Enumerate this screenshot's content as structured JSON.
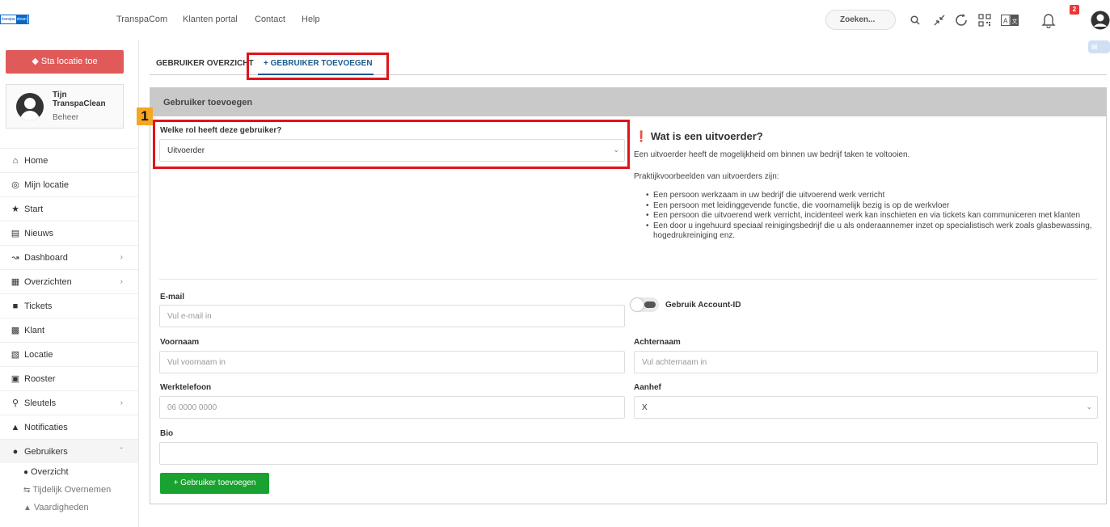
{
  "topbar": {
    "logo_text_1": "transpa",
    "logo_text_2": "clean",
    "nav": [
      "TranspaCom",
      "Klanten portal",
      "Contact",
      "Help"
    ],
    "search_placeholder": "Zoeken...",
    "notification_count": "2",
    "icons": [
      "search-icon",
      "collapse-icon",
      "refresh-icon",
      "qr-code-icon",
      "translate-icon",
      "bell-icon",
      "user-avatar-icon"
    ]
  },
  "sidebar": {
    "location_button": "Sta locatie toe",
    "profile": {
      "name": "Tijn",
      "company": "TranspaClean",
      "role": "Beheer"
    },
    "items": [
      {
        "label": "Home",
        "icon": "home-icon",
        "has_children": false
      },
      {
        "label": "Mijn locatie",
        "icon": "globe-icon",
        "has_children": false
      },
      {
        "label": "Start",
        "icon": "star-icon",
        "has_children": false
      },
      {
        "label": "Nieuws",
        "icon": "newspaper-icon",
        "has_children": false
      },
      {
        "label": "Dashboard",
        "icon": "chart-icon",
        "has_children": true
      },
      {
        "label": "Overzichten",
        "icon": "file-icon",
        "has_children": true
      },
      {
        "label": "Tickets",
        "icon": "comment-icon",
        "has_children": false
      },
      {
        "label": "Klant",
        "icon": "building-icon",
        "has_children": false
      },
      {
        "label": "Locatie",
        "icon": "location-building-icon",
        "has_children": false
      },
      {
        "label": "Rooster",
        "icon": "calendar-icon",
        "has_children": false
      },
      {
        "label": "Sleutels",
        "icon": "key-icon",
        "has_children": true
      },
      {
        "label": "Notificaties",
        "icon": "bell-icon",
        "has_children": false
      },
      {
        "label": "Gebruikers",
        "icon": "users-icon",
        "has_children": true
      }
    ],
    "subitems": [
      {
        "label": "Overzicht",
        "icon": "users-cog-icon"
      },
      {
        "label": "Tijdelijk Overnemen",
        "icon": "exchange-icon"
      },
      {
        "label": "Vaardigheden",
        "icon": "graduation-icon"
      }
    ]
  },
  "tabs": {
    "overview": "GEBRUIKER OVERZICHT",
    "add": "+ GEBRUIKER TOEVOEGEN"
  },
  "annotation": {
    "step_number": "1"
  },
  "form": {
    "card_title": "Gebruiker toevoegen",
    "role_label": "Welke rol heeft deze gebruiker?",
    "role_value": "Uitvoerder",
    "email_label": "E-mail",
    "email_placeholder": "Vul e-mail in",
    "account_id_label": "Gebruik Account-ID",
    "firstname_label": "Voornaam",
    "firstname_placeholder": "Vul voornaam in",
    "lastname_label": "Achternaam",
    "lastname_placeholder": "Vul achternaam in",
    "phone_label": "Werktelefoon",
    "phone_placeholder": "06 0000 0000",
    "salutation_label": "Aanhef",
    "salutation_value": "X",
    "bio_label": "Bio",
    "submit_label": "+ Gebruiker toevoegen"
  },
  "info": {
    "title": "Wat is een uitvoerder?",
    "intro": "Een uitvoerder heeft de mogelijkheid om binnen uw bedrijf taken te voltooien.",
    "examples_heading": "Praktijkvoorbeelden van uitvoerders zijn:",
    "examples": [
      "Een persoon werkzaam in uw bedrijf die uitvoerend werk verricht",
      "Een persoon met leidinggevende functie, die voornamelijk bezig is op de werkvloer",
      "Een persoon die uitvoerend werk verricht, incidenteel werk kan inschieten en via tickets kan communiceren met klanten",
      "Een door u ingehuurd speciaal reinigingsbedrijf die u als onderaannemer inzet op specialistisch werk zoals glasbewassing, hogedrukreiniging enz."
    ]
  },
  "colors": {
    "accent": "#1a5b8c",
    "danger_button": "#e05a5a",
    "success_button": "#19a22f",
    "highlight_box": "#e0131b",
    "step_badge": "#f5a623"
  }
}
